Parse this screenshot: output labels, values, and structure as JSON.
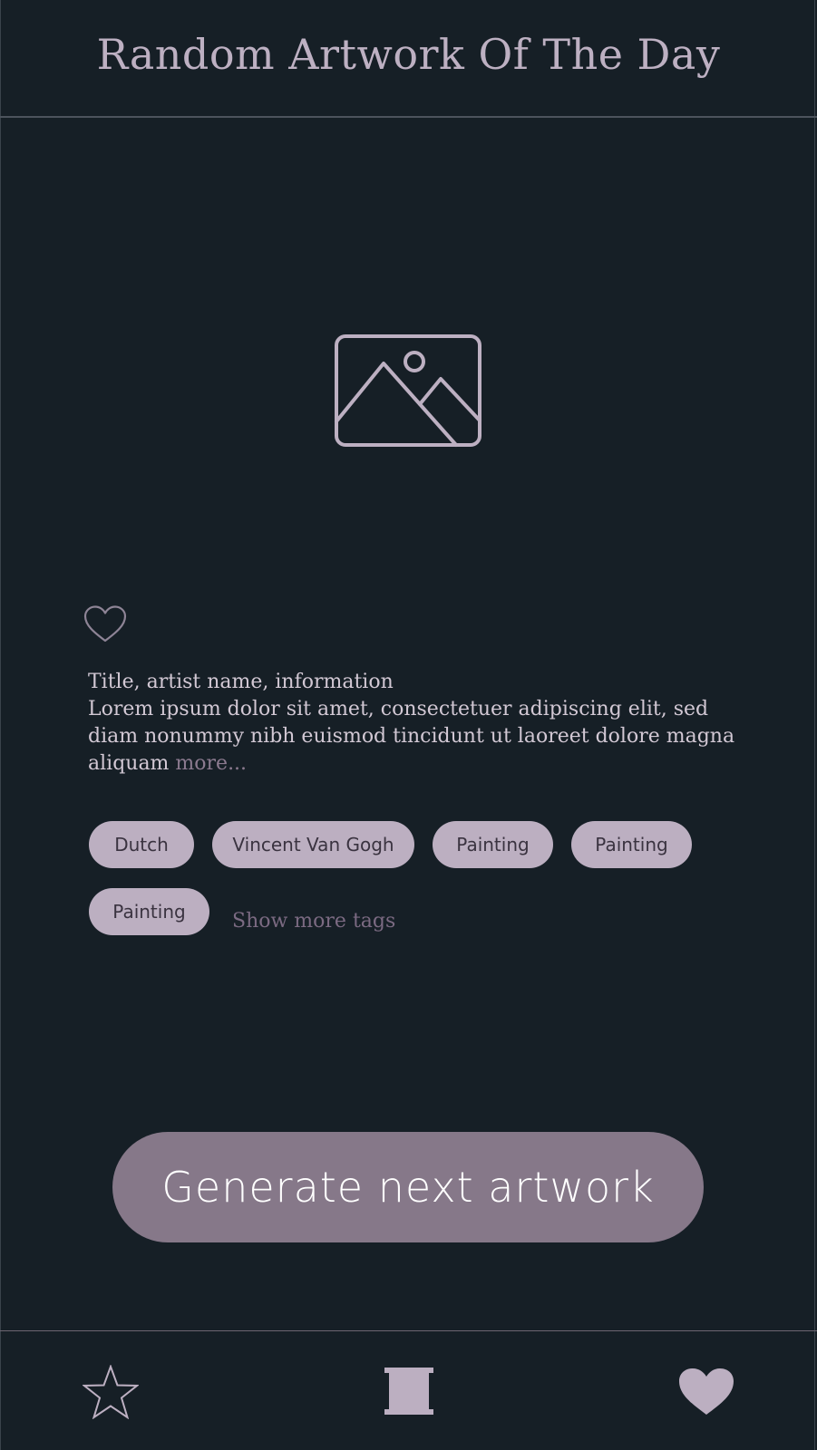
{
  "header": {
    "title": "Random Artwork Of The Day"
  },
  "artwork": {
    "placeholder_icon": "image-placeholder-icon",
    "liked": false
  },
  "info": {
    "title": "Title, artist name, information",
    "description": "Lorem ipsum dolor sit amet, consectetuer adipiscing elit, sed diam nonummy nibh euismod tincidunt ut laoreet dolore magna aliquam ",
    "more_label": "more..."
  },
  "tags": {
    "items": [
      "Dutch",
      "Vincent Van Gogh",
      "Painting",
      "Painting",
      "Painting"
    ],
    "show_more_label": "Show more tags"
  },
  "actions": {
    "generate_label": "Generate next artwork"
  },
  "bottom_nav": {
    "items": [
      {
        "icon": "star-outline-icon"
      },
      {
        "icon": "scroll-icon"
      },
      {
        "icon": "heart-filled-icon"
      }
    ]
  },
  "colors": {
    "background": "#161f26",
    "accent": "#bcafc1",
    "button": "#867889",
    "muted_text": "#7b6a82"
  }
}
